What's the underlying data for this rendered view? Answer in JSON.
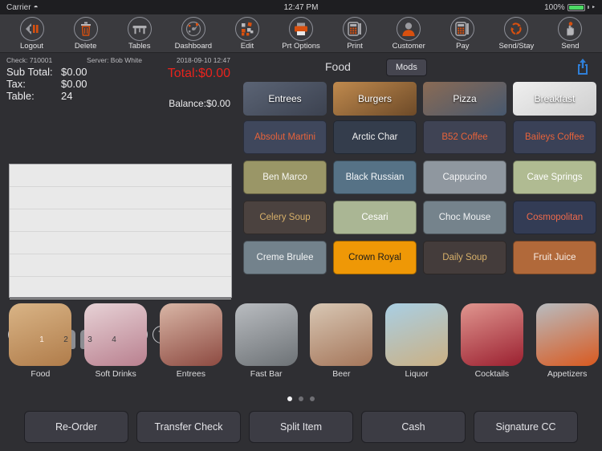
{
  "status_bar": {
    "carrier": "Carrier",
    "wifi_icon": "wifi-icon",
    "time": "12:47 PM",
    "battery_percent": "100%"
  },
  "toolbar": {
    "buttons": [
      {
        "label": "Logout",
        "icon": "logout-arrow-icon"
      },
      {
        "label": "Delete",
        "icon": "trash-icon"
      },
      {
        "label": "Tables",
        "icon": "table-icon"
      },
      {
        "label": "Dashboard",
        "icon": "gauge-icon"
      },
      {
        "label": "Edit",
        "icon": "squares-edit-icon"
      },
      {
        "label": "Prt Options",
        "icon": "printer-icon"
      },
      {
        "label": "Print",
        "icon": "print-terminal-icon"
      },
      {
        "label": "Customer",
        "icon": "person-icon"
      },
      {
        "label": "Pay",
        "icon": "pay-terminal-icon"
      },
      {
        "label": "Send/Stay",
        "icon": "recycle-arrows-icon"
      },
      {
        "label": "Send",
        "icon": "hand-tap-icon"
      }
    ]
  },
  "check": {
    "check_label": "Check: 710001",
    "server_label": "Server: Bob White",
    "datetime": "2018-09-10 12:47",
    "subtotal_label": "Sub Total:",
    "subtotal_value": "$0.00",
    "tax_label": "Tax:",
    "tax_value": "$0.00",
    "table_label": "Table:",
    "table_value": "24",
    "total_text": "Total:$0.00",
    "balance_text": "Balance:$0.00",
    "total_color": "#e8231d"
  },
  "seats": {
    "first_button": "F",
    "add_button": "+",
    "last_button": "T",
    "items": [
      {
        "number": "1",
        "active": true
      },
      {
        "number": "2",
        "active": false
      },
      {
        "number": "3",
        "active": false
      },
      {
        "number": "4",
        "active": false
      }
    ]
  },
  "menu_panel": {
    "title": "Food",
    "mods_label": "Mods",
    "share_icon": "share-icon",
    "categories": [
      {
        "label": "Entrees",
        "image": "entrees-photo",
        "c1": "#5b6475",
        "c2": "#3c4250"
      },
      {
        "label": "Burgers",
        "image": "burgers-photo",
        "c1": "#c08a4e",
        "c2": "#6d4a28"
      },
      {
        "label": "Pizza",
        "image": "pizza-photo",
        "c1": "#8a6b55",
        "c2": "#47586e"
      },
      {
        "label": "Breakfast",
        "image": "breakfast-egg-photo",
        "c1": "#efefef",
        "c2": "#cfcfcf"
      }
    ],
    "items": [
      {
        "label": "Absolut Martini",
        "bg": "#3f475c",
        "fg": "#e8633a"
      },
      {
        "label": "Arctic Char",
        "bg": "#343d4c",
        "fg": "#f2f2f2"
      },
      {
        "label": "B52 Coffee",
        "bg": "#3f4354",
        "fg": "#e8633a"
      },
      {
        "label": "Baileys Coffee",
        "bg": "#3a4157",
        "fg": "#e8633a"
      },
      {
        "label": "Ben Marco",
        "bg": "#9a9667",
        "fg": "#f7f7f2"
      },
      {
        "label": "Black Russian",
        "bg": "#567286",
        "fg": "#f4f7f9"
      },
      {
        "label": "Cappucino",
        "bg": "#8f979f",
        "fg": "#f3f4f5"
      },
      {
        "label": "Cave Springs",
        "bg": "#b0bb92",
        "fg": "#ffffff"
      },
      {
        "label": "Celery Soup",
        "bg": "#4b423f",
        "fg": "#d7b06a"
      },
      {
        "label": "Cesari",
        "bg": "#aab694",
        "fg": "#ffffff"
      },
      {
        "label": "Choc Mouse",
        "bg": "#75838c",
        "fg": "#f0f2f3"
      },
      {
        "label": "Cosmopolitan",
        "bg": "#333c55",
        "fg": "#ef6a4b"
      },
      {
        "label": "Creme Brulee",
        "bg": "#73828c",
        "fg": "#f2f4f5"
      },
      {
        "label": "Crown Royal",
        "bg": "#ef9806",
        "fg": "#1b1b1b"
      },
      {
        "label": "Daily Soup",
        "bg": "#443c3b",
        "fg": "#d7b06a"
      },
      {
        "label": "Fruit Juice",
        "bg": "#b1693a",
        "fg": "#f7ece4"
      }
    ]
  },
  "carousel": {
    "items": [
      {
        "label": "Food",
        "image": "fish-plate-photo",
        "c1": "#d9b486",
        "c2": "#b07c4a"
      },
      {
        "label": "Soft Drinks",
        "image": "soda-bottle-photo",
        "c1": "#e7d2d6",
        "c2": "#b9808f"
      },
      {
        "label": "Entrees",
        "image": "woman-steak-photo",
        "c1": "#d9b6a6",
        "c2": "#8d4a41"
      },
      {
        "label": "Fast Bar",
        "image": "food-truck-photo",
        "c1": "#b9bcc0",
        "c2": "#6d7276"
      },
      {
        "label": "Beer",
        "image": "beer-mouth-photo",
        "c1": "#d8c7b4",
        "c2": "#a5765a"
      },
      {
        "label": "Liquor",
        "image": "liquor-sign-photo",
        "c1": "#a9cfe4",
        "c2": "#cbb083"
      },
      {
        "label": "Cocktails",
        "image": "cocktail-woman-photo",
        "c1": "#e0968f",
        "c2": "#9b2030"
      },
      {
        "label": "Appetizers",
        "image": "tomato-soup-photo",
        "c1": "#b8bcc0",
        "c2": "#d9591f"
      }
    ]
  },
  "pager": {
    "total": 3,
    "active_index": 0
  },
  "actions": {
    "buttons": [
      {
        "label": "Re-Order"
      },
      {
        "label": "Transfer Check"
      },
      {
        "label": "Split Item"
      },
      {
        "label": "Cash"
      },
      {
        "label": "Signature CC"
      }
    ]
  }
}
